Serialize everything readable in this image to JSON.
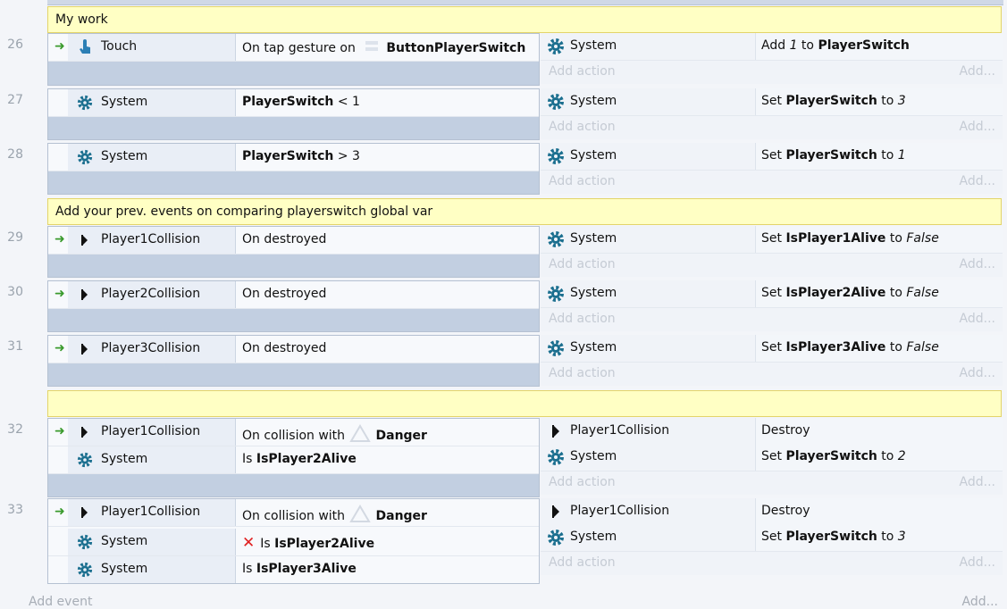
{
  "comments": [
    "My work",
    "Add your prev. events on comparing playerswitch global var",
    ""
  ],
  "events": [
    {
      "num": "26",
      "conds": [
        {
          "obj": "Touch",
          "icon": "touch-icon",
          "trigger": true,
          "t1": "On tap gesture on ",
          "icon2": "button-icon",
          "b1": "ButtonPlayerSwitch"
        }
      ],
      "acts": [
        {
          "obj": "System",
          "t1": "Add ",
          "i1": "1",
          "t2": " to ",
          "b1": "PlayerSwitch"
        }
      ]
    },
    {
      "num": "27",
      "conds": [
        {
          "obj": "System",
          "icon": "gear-icon",
          "b1": "PlayerSwitch",
          "t1": "< 1"
        }
      ],
      "acts": [
        {
          "obj": "System",
          "t1": "Set ",
          "b1": "PlayerSwitch",
          "t2": " to ",
          "i1": "3"
        }
      ]
    },
    {
      "num": "28",
      "conds": [
        {
          "obj": "System",
          "icon": "gear-icon",
          "b1": "PlayerSwitch",
          "t1": "> 3"
        }
      ],
      "acts": [
        {
          "obj": "System",
          "t1": "Set ",
          "b1": "PlayerSwitch",
          "t2": " to ",
          "i1": "1"
        }
      ]
    },
    {
      "num": "29",
      "conds": [
        {
          "obj": "Player1Collision",
          "t1": "On destroyed"
        }
      ],
      "acts": [
        {
          "obj": "System",
          "t1": "Set ",
          "b1": "IsPlayer1Alive",
          "t2": " to ",
          "i1": "False"
        }
      ]
    },
    {
      "num": "30",
      "conds": [
        {
          "obj": "Player2Collision",
          "t1": "On destroyed"
        }
      ],
      "acts": [
        {
          "obj": "System",
          "t1": "Set ",
          "b1": "IsPlayer2Alive",
          "t2": " to ",
          "i1": "False"
        }
      ]
    },
    {
      "num": "31",
      "conds": [
        {
          "obj": "Player3Collision",
          "t1": "On destroyed"
        }
      ],
      "acts": [
        {
          "obj": "System",
          "t1": "Set ",
          "b1": "IsPlayer3Alive",
          "t2": " to ",
          "i1": "False"
        }
      ]
    },
    {
      "num": "32",
      "conds": [
        {
          "obj": "Player1Collision",
          "t1": "On collision with ",
          "b1": "Danger"
        },
        {
          "obj": "System",
          "t1": "Is ",
          "b1": "IsPlayer2Alive"
        }
      ],
      "acts": [
        {
          "obj": "Player1Collision",
          "t1": "Destroy"
        },
        {
          "obj": "System",
          "t1": "Set ",
          "b1": "PlayerSwitch",
          "t2": " to ",
          "i1": "2"
        }
      ]
    },
    {
      "num": "33",
      "conds": [
        {
          "obj": "Player1Collision",
          "t1": "On collision with ",
          "b1": "Danger"
        },
        {
          "obj": "System",
          "t1": "Is ",
          "b1": "IsPlayer2Alive"
        },
        {
          "obj": "System",
          "t1": "Is ",
          "b1": "IsPlayer3Alive"
        }
      ],
      "acts": [
        {
          "obj": "Player1Collision",
          "t1": "Destroy"
        },
        {
          "obj": "System",
          "t1": "Set ",
          "b1": "PlayerSwitch",
          "t2": " to ",
          "i1": "3"
        }
      ]
    }
  ],
  "add_action_label": "Add action",
  "add_short_label": "Add...",
  "add_event_label": "Add event",
  "colors": {
    "trigger_arrow": "#3a9a2c",
    "gear": "#1b6f8f",
    "invert_x": "#e02020",
    "comment_bg": "#ffffc4"
  }
}
